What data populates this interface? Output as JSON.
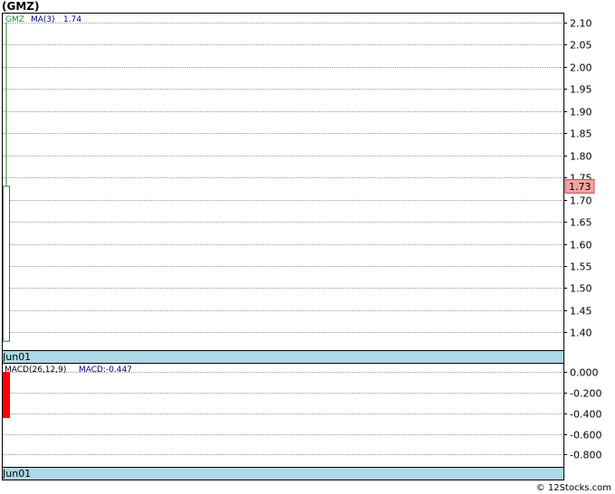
{
  "title": "(GMZ)",
  "copyright": "© 12Stocks.com",
  "chart_data": [
    {
      "type": "candlestick",
      "ticker_label": "GMZ",
      "ma_label": "MA(3)",
      "ma_value": "1.74",
      "date_label": "Jun01",
      "ylim": [
        1.36,
        2.12
      ],
      "y_ticks": [
        "2.10",
        "2.05",
        "2.00",
        "1.95",
        "1.90",
        "1.85",
        "1.80",
        "1.75",
        "1.70",
        "1.65",
        "1.60",
        "1.55",
        "1.50",
        "1.45",
        "1.40"
      ],
      "y_tick_values": [
        2.1,
        2.05,
        2.0,
        1.95,
        1.9,
        1.85,
        1.8,
        1.75,
        1.7,
        1.65,
        1.6,
        1.55,
        1.5,
        1.45,
        1.4
      ],
      "last_price": "1.73",
      "candles": [
        {
          "date": "Jun01",
          "open": 1.38,
          "close": 1.73,
          "high": 2.1,
          "low": 1.38
        }
      ],
      "colors": {
        "up": "#2e7d32",
        "ma": "#000080",
        "last_price_bg": "#f4a3a3",
        "date_bar": "#add8e6"
      }
    },
    {
      "type": "bar",
      "label": "MACD(26,12,9)",
      "value_label": "MACD:-0.447",
      "date_label": "Jun01",
      "ylim": [
        -0.92,
        0.08
      ],
      "y_ticks": [
        "0.000",
        "-0.200",
        "-0.400",
        "-0.600",
        "-0.800"
      ],
      "y_tick_values": [
        0.0,
        -0.2,
        -0.4,
        -0.6,
        -0.8
      ],
      "values": [
        -0.447
      ],
      "colors": {
        "bar": "#ff0000",
        "value": "#000080"
      }
    }
  ]
}
